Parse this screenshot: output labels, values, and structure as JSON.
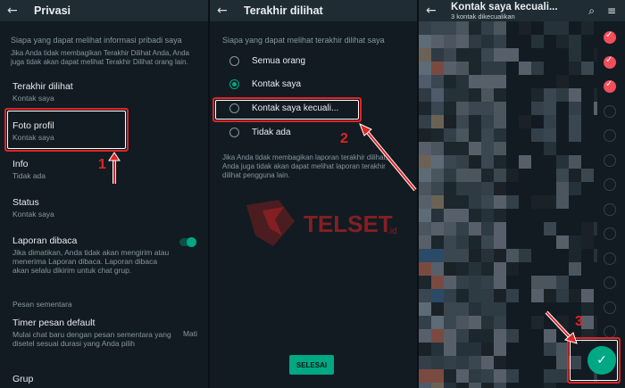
{
  "panel1": {
    "title": "Privasi",
    "section_header": "Siapa yang dapat melihat informasi pribadi saya",
    "section_desc": "Jika Anda tidak membagikan Terakhir Dilihat Anda, Anda juga tidak akan dapat melihat Terakhir Dilihat orang lain.",
    "items": [
      {
        "title": "Terakhir dilihat",
        "subtitle": "Kontak saya"
      },
      {
        "title": "Foto profil",
        "subtitle": "Kontak saya"
      },
      {
        "title": "Info",
        "subtitle": "Tidak ada"
      },
      {
        "title": "Status",
        "subtitle": "Kontak saya"
      },
      {
        "title": "Laporan dibaca",
        "subtitle": "Jika dimatikan, Anda tidak akan mengirim atau menerima Laporan dibaca. Laporan dibaca akan selalu dikirim untuk chat grup."
      }
    ],
    "read_receipts_enabled": true,
    "temp_header": "Pesan sementara",
    "timer": {
      "title": "Timer pesan default",
      "subtitle": "Mulai chat baru dengan pesan sementara yang disetel sesuai durasi yang Anda pilih",
      "value": "Mati"
    },
    "group_title": "Grup"
  },
  "panel2": {
    "title": "Terakhir dilihat",
    "section_header": "Siapa yang dapat melihat terakhir dilihat saya",
    "options": [
      "Semua orang",
      "Kontak saya",
      "Kontak saya kecuali...",
      "Tidak ada"
    ],
    "selected_index": 1,
    "note": "Jika Anda tidak membagikan laporan terakhir dilihat, Anda juga tidak akan dapat melihat laporan terakhir dilihat pengguna lain.",
    "done_label": "SELESAI"
  },
  "panel3": {
    "title": "Kontak saya kecuali...",
    "subtitle": "3 kontak dikecualikan",
    "checked": [
      true,
      true,
      true,
      false,
      false,
      false,
      false,
      false,
      false,
      false,
      false,
      false,
      false,
      false
    ]
  },
  "annotations": {
    "n1": "1",
    "n2": "2",
    "n3": "3"
  },
  "watermark": {
    "brand": "TELSET",
    "suffix": ".id"
  },
  "colors": {
    "accent": "#00a884",
    "annotation": "#e02424",
    "excluded": "#f24e5a",
    "background": "#121b22"
  }
}
